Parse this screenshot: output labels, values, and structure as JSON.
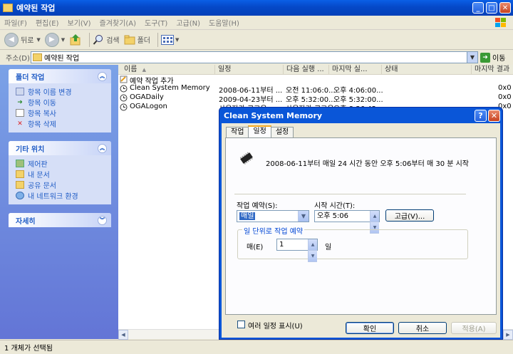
{
  "window": {
    "title": "예약된 작업"
  },
  "menu": [
    "파일(F)",
    "편집(E)",
    "보기(V)",
    "즐겨찾기(A)",
    "도구(T)",
    "고급(N)",
    "도움말(H)"
  ],
  "toolbar": {
    "back": "뒤로",
    "search": "검색",
    "folders": "폴더"
  },
  "address": {
    "label": "주소(D)",
    "value": "예약된 작업",
    "go": "이동"
  },
  "left_panels": [
    {
      "title": "폴더 작업",
      "items": [
        "항목 이름 변경",
        "항목 이동",
        "항목 복사",
        "항목 삭제"
      ]
    },
    {
      "title": "기타 위치",
      "items": [
        "제어판",
        "내 문서",
        "공유 문서",
        "내 네트워크 환경"
      ]
    },
    {
      "title": "자세히",
      "items": []
    }
  ],
  "list": {
    "columns": [
      "이름",
      "일정",
      "다음 실행 ...",
      "마지막 실...",
      "상태",
      "마지막 결과"
    ],
    "rows": [
      {
        "name": "예약 작업 추가",
        "schedule": "",
        "next": "",
        "last": "",
        "status": "",
        "result": ""
      },
      {
        "name": "Clean System Memory",
        "schedule": "2008-06-11부터 ...",
        "next": "오전 11:06:0...",
        "last": "오후 4:06:00...",
        "status": "",
        "result": "0x0"
      },
      {
        "name": "OGADaily",
        "schedule": "2009-04-23부터 ...",
        "next": "오후 5:32:00...",
        "last": "오후 5:32:00...",
        "status": "",
        "result": "0x0"
      },
      {
        "name": "OGALogon",
        "schedule": "사용자가 로그온 ...",
        "next": "사용자가 로그온 ...",
        "last": "오후 8:36:42...",
        "status": "",
        "result": "0x0"
      }
    ]
  },
  "status": {
    "text": "1 개체가 선택됨"
  },
  "dialog": {
    "title": "Clean System Memory",
    "tabs": [
      "작업",
      "일정",
      "설정"
    ],
    "active_tab": "일정",
    "summary": "2008-06-11부터 매일 24 시간 동안 오후 5:06부터 매 30 분 시작",
    "schedule_label": "작업 예약(S):",
    "schedule_value": "매일",
    "start_label": "시작 시간(T):",
    "start_value": "오후  5:06",
    "advanced_button": "고급(V)...",
    "group_title": "일 단위로 작업 예약",
    "every_label": "매(E)",
    "every_value": "1",
    "day_unit": "일",
    "multi_label": "여러 일정 표시(U)",
    "ok": "확인",
    "cancel": "취소",
    "apply": "적용(A)"
  }
}
